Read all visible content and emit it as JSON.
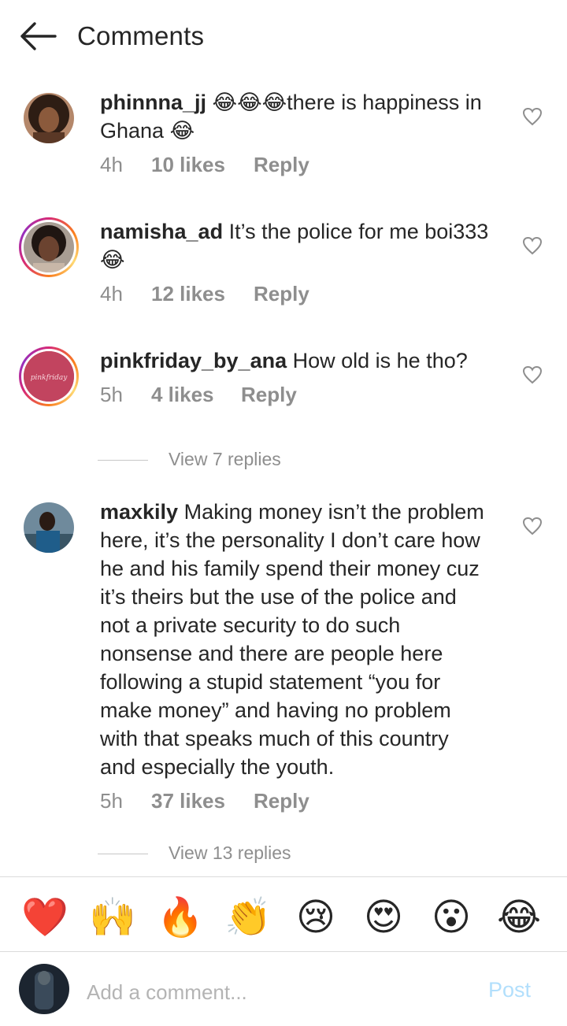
{
  "header": {
    "title": "Comments"
  },
  "comments": [
    {
      "username": "phinnna_jj",
      "text_lines": [
        "😂😂😂there is happiness in",
        "Ghana 😂"
      ],
      "time": "4h",
      "likes": "10 likes",
      "reply": "Reply"
    },
    {
      "username": "namisha_ad",
      "text_lines": [
        "It’s the police for me boi333",
        "😂"
      ],
      "time": "4h",
      "likes": "12 likes",
      "reply": "Reply"
    },
    {
      "username": "pinkfriday_by_ana",
      "text_lines": [
        "How old is he tho?"
      ],
      "time": "5h",
      "likes": "4 likes",
      "reply": "Reply",
      "view_replies": "View 7 replies"
    },
    {
      "username": "maxkily",
      "text_lines": [
        "Making money isn’t the problem",
        "here, it’s the personality I don’t care how",
        "he and his family spend their money cuz",
        "it’s theirs but the use of the police and",
        "not a private security to do such",
        "nonsense and there are people here",
        "following a stupid statement “you for",
        "make money” and having no problem",
        "with that speaks much of this country",
        "and especially the youth."
      ],
      "time": "5h",
      "likes": "37 likes",
      "reply": "Reply",
      "view_replies": "View 13 replies"
    }
  ],
  "avatar_logo_text": "pinkfriday",
  "emoji_bar": [
    "❤️",
    "🙌",
    "🔥",
    "👏",
    "😢",
    "😍",
    "😮",
    "😂"
  ],
  "composer": {
    "placeholder": "Add a comment...",
    "post_label": "Post"
  },
  "colors": {
    "text": "#262626",
    "muted": "#8e8e8e",
    "post_disabled": "#b2dffc",
    "divider": "#dbdbdb"
  }
}
